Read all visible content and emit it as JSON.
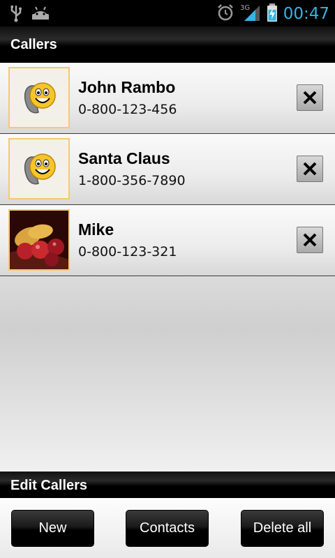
{
  "status_bar": {
    "clock": "00:47",
    "network": "3G",
    "icons": [
      "usb-icon",
      "android-icon",
      "alarm-icon",
      "signal-icon",
      "battery-charging-icon"
    ],
    "clock_color": "#33b5e5"
  },
  "callers_section": {
    "title": "Callers"
  },
  "callers": [
    {
      "name": "John Rambo",
      "phone": "0-800-123-456",
      "avatar": "smiley-phone-icon"
    },
    {
      "name": "Santa Claus",
      "phone": "1-800-356-7890",
      "avatar": "smiley-phone-icon"
    },
    {
      "name": "Mike",
      "phone": "0-800-123-321",
      "avatar": "contact-photo"
    }
  ],
  "edit_section": {
    "title": "Edit Callers"
  },
  "buttons": {
    "new": "New",
    "contacts": "Contacts",
    "delete_all": "Delete all"
  },
  "colors": {
    "avatar_border": "#f7c96a"
  }
}
